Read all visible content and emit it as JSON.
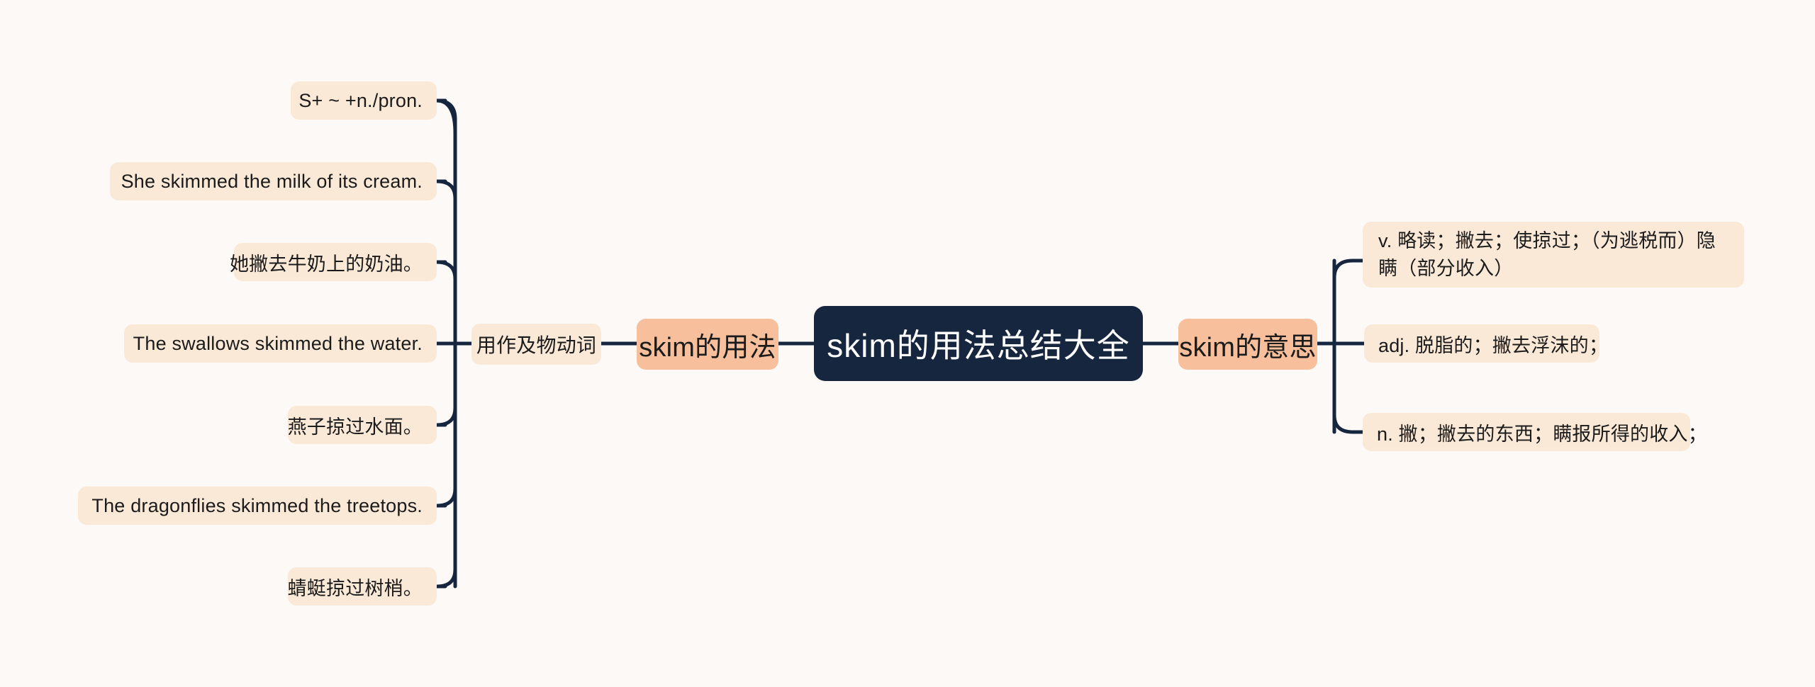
{
  "theme": {
    "background": "#fdf9f7",
    "root_bg": "#16263f",
    "root_text": "#ffffff",
    "branch_bg": "#f7bf9b",
    "leaf_bg": "#fbe9d8",
    "connector": "#16263f",
    "text": "#1b1b1b"
  },
  "mindmap": {
    "root": {
      "label": "skim的用法总结大全"
    },
    "left_branch": {
      "label": "skim的用法",
      "child": {
        "label": "用作及物动词",
        "leaves": [
          {
            "label": "S+ ~ +n./pron."
          },
          {
            "label": "She skimmed the milk of its cream."
          },
          {
            "label": "她撇去牛奶上的奶油。"
          },
          {
            "label": "The swallows skimmed the water."
          },
          {
            "label": "燕子掠过水面。"
          },
          {
            "label": "The dragonflies skimmed the treetops."
          },
          {
            "label": "蜻蜓掠过树梢。"
          }
        ]
      }
    },
    "right_branch": {
      "label": "skim的意思",
      "leaves": [
        {
          "label": "v. 略读；撇去；使掠过；（为逃税而）隐瞒（部分收入）"
        },
        {
          "label": "adj. 脱脂的；撇去浮沫的；"
        },
        {
          "label": "n. 撇；撇去的东西；瞒报所得的收入；"
        }
      ]
    }
  }
}
